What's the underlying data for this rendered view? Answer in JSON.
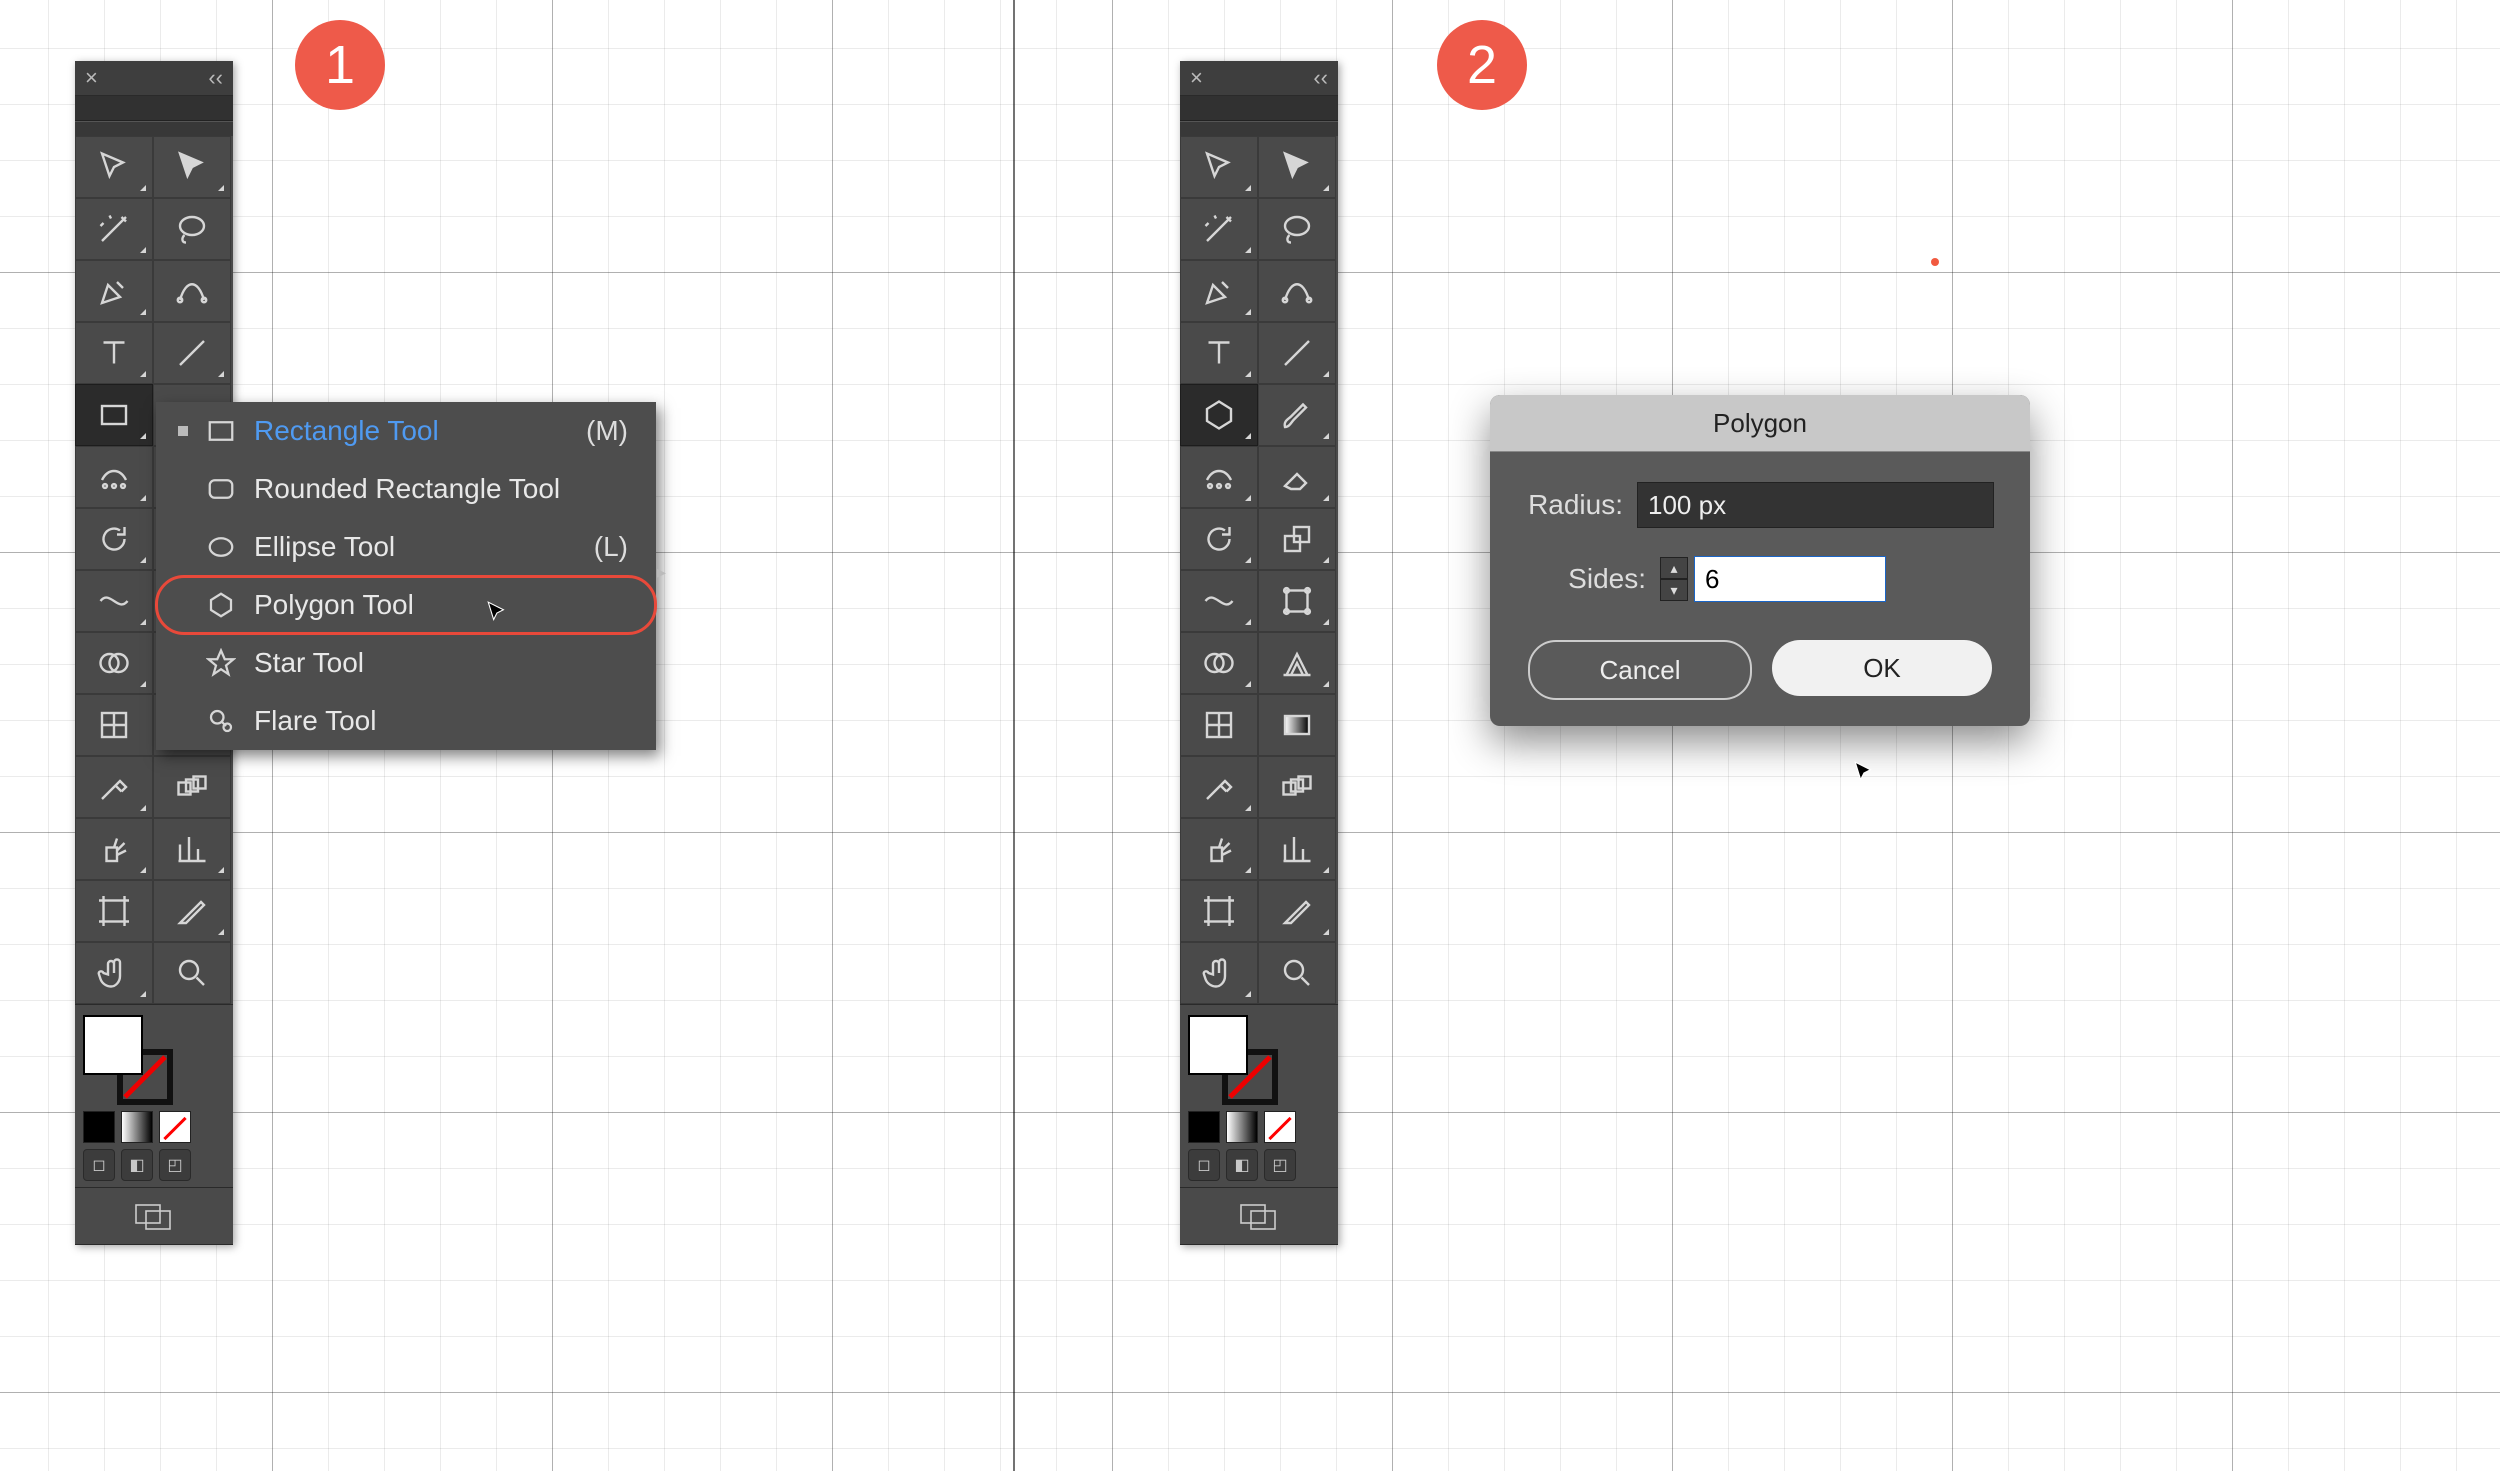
{
  "steps": {
    "one": "1",
    "two": "2"
  },
  "toolbar": {
    "tools": [
      "selection-tool",
      "direct-selection-tool",
      "magic-wand-tool",
      "lasso-tool",
      "pen-tool",
      "curvature-tool",
      "type-tool",
      "line-segment-tool",
      "rectangle-tool",
      "paintbrush-tool",
      "shaper-tool",
      "eraser-tool",
      "rotate-tool",
      "scale-tool",
      "width-tool",
      "free-transform-tool",
      "shape-builder-tool",
      "perspective-grid-tool",
      "mesh-tool",
      "gradient-tool",
      "eyedropper-tool",
      "blend-tool",
      "symbol-sprayer-tool",
      "column-graph-tool",
      "artboard-tool",
      "slice-tool",
      "hand-tool",
      "zoom-tool"
    ],
    "active_step1": "rectangle-tool",
    "active_step2": "polygon-tool"
  },
  "flyout": {
    "items": [
      {
        "icon": "rectangle-icon",
        "label": "Rectangle Tool",
        "shortcut": "(M)",
        "active": true
      },
      {
        "icon": "rounded-rectangle-icon",
        "label": "Rounded Rectangle Tool",
        "shortcut": ""
      },
      {
        "icon": "ellipse-icon",
        "label": "Ellipse Tool",
        "shortcut": "(L)"
      },
      {
        "icon": "polygon-icon",
        "label": "Polygon Tool",
        "shortcut": "",
        "highlight": true
      },
      {
        "icon": "star-icon",
        "label": "Star Tool",
        "shortcut": ""
      },
      {
        "icon": "flare-icon",
        "label": "Flare Tool",
        "shortcut": ""
      }
    ]
  },
  "dialog": {
    "title": "Polygon",
    "radius_label": "Radius:",
    "radius_value": "100 px",
    "sides_label": "Sides:",
    "sides_value": "6",
    "cancel": "Cancel",
    "ok": "OK"
  }
}
